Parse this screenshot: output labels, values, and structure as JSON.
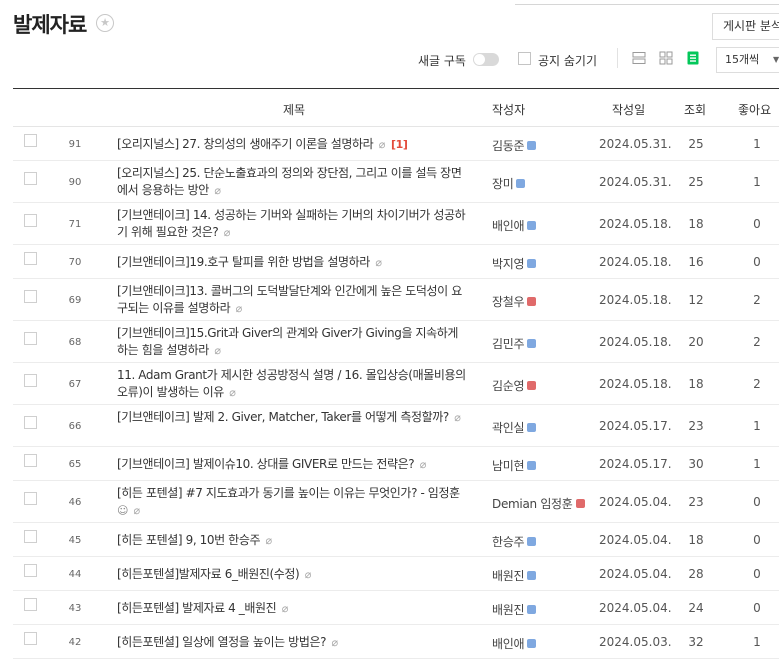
{
  "header": {
    "title": "발제자료",
    "analysis_button": "게시판 분석"
  },
  "toolbar": {
    "subscribe_label": "새글 구독",
    "hide_notice_label": "공지 숨기기",
    "count_select": "15개씩"
  },
  "table": {
    "columns": {
      "title": "제목",
      "author": "작성자",
      "date": "작성일",
      "views": "조회",
      "likes": "좋아요"
    },
    "rows": [
      {
        "num": "91",
        "title": "[오리지널스] 27. 창의성의 생애주기 이론을 설명하라",
        "clip": true,
        "reply": "[1]",
        "author": "김동준",
        "badge": "blue",
        "date": "2024.05.31.",
        "views": "25",
        "likes": "1"
      },
      {
        "num": "90",
        "title": "[오리지널스] 25. 단순노출효과의 정의와 장단점, 그리고 이를 설득 장면에서 응용하는 방안",
        "clip": true,
        "author": "장미",
        "badge": "blue",
        "date": "2024.05.31.",
        "views": "25",
        "likes": "1"
      },
      {
        "num": "71",
        "title": "[기브앤테이크] 14. 성공하는 기버와 실패하는 기버의 차이기버가 성공하기 위해 필요한 것은?",
        "clip": true,
        "author": "배인애",
        "badge": "blue",
        "date": "2024.05.18.",
        "views": "18",
        "likes": "0"
      },
      {
        "num": "70",
        "title": "[기브앤테이크]19.호구 탈피를 위한 방법을 설명하라",
        "clip": true,
        "author": "박지영",
        "badge": "blue",
        "date": "2024.05.18.",
        "views": "16",
        "likes": "0"
      },
      {
        "num": "69",
        "title": "[기브앤테이크]13. 콜버그의 도덕발달단계와 인간에게 높은 도덕성이 요구되는 이유를 설명하라",
        "clip": true,
        "author": "장철우",
        "badge": "red",
        "date": "2024.05.18.",
        "views": "12",
        "likes": "2"
      },
      {
        "num": "68",
        "title": "[기브앤테이크]15.Grit과 Giver의 관계와 Giver가 Giving을 지속하게 하는 힘을 설명하라",
        "clip": true,
        "author": "김민주",
        "badge": "blue",
        "date": "2024.05.18.",
        "views": "20",
        "likes": "2"
      },
      {
        "num": "67",
        "title": "11. Adam Grant가 제시한 성공방정식 설명 / 16. 몰입상승(매몰비용의오류)이 발생하는 이유",
        "clip": true,
        "author": "김순영",
        "badge": "red",
        "date": "2024.05.18.",
        "views": "18",
        "likes": "2"
      },
      {
        "num": "66",
        "title": "[기브앤테이크] 발제 2. Giver, Matcher, Taker를 어떻게 측정할까?",
        "clip": true,
        "author": "곽인실",
        "badge": "blue",
        "date": "2024.05.17.",
        "views": "23",
        "likes": "1"
      },
      {
        "num": "65",
        "title": "[기브앤테이크] 발제이슈10. 상대를 GIVER로 만드는 전략은?",
        "clip": true,
        "author": "남미현",
        "badge": "blue",
        "date": "2024.05.17.",
        "views": "30",
        "likes": "1"
      },
      {
        "num": "46",
        "title": "[히든 포텐셜] #7 지도효과가 동기를 높이는 이유는 무엇인가? - 임정훈",
        "emoji": "☺",
        "clip": true,
        "author": "Demian 임정훈",
        "badge": "red",
        "date": "2024.05.04.",
        "views": "23",
        "likes": "0"
      },
      {
        "num": "45",
        "title": "[히든 포텐셜] 9, 10번 한승주",
        "clip": true,
        "author": "한승주",
        "badge": "blue",
        "date": "2024.05.04.",
        "views": "18",
        "likes": "0"
      },
      {
        "num": "44",
        "title": "[히든포텐셜]발제자료 6_배원진(수정)",
        "clip": true,
        "author": "배원진",
        "badge": "blue",
        "date": "2024.05.04.",
        "views": "28",
        "likes": "0"
      },
      {
        "num": "43",
        "title": "[히든포텐셜] 발제자료 4 _배원진",
        "clip": true,
        "author": "배원진",
        "badge": "blue",
        "date": "2024.05.04.",
        "views": "24",
        "likes": "0"
      },
      {
        "num": "42",
        "title": "[히든포텐셜] 일상에 열정을 높이는 방법은?",
        "clip": true,
        "author": "배인애",
        "badge": "blue",
        "date": "2024.05.03.",
        "views": "32",
        "likes": "1"
      }
    ]
  }
}
